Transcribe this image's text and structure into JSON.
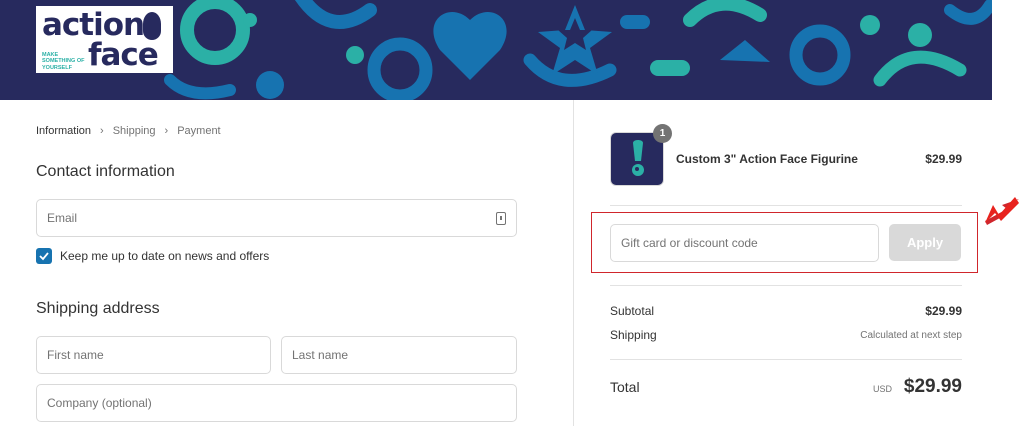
{
  "brand": {
    "logo_line1": "action",
    "logo_line2": "face",
    "tagline": "MAKE SOMETHING OF YOURSELF"
  },
  "breadcrumb": {
    "step1": "Information",
    "step2": "Shipping",
    "step3": "Payment"
  },
  "contact": {
    "title": "Contact information",
    "email_placeholder": "Email",
    "newsletter_label": "Keep me up to date on news and offers",
    "newsletter_checked": true
  },
  "shipping": {
    "title": "Shipping address",
    "first_name_placeholder": "First name",
    "last_name_placeholder": "Last name",
    "company_placeholder": "Company (optional)"
  },
  "cart": {
    "item": {
      "name": "Custom 3\" Action Face Figurine",
      "price": "$29.99",
      "quantity": "1"
    },
    "discount_placeholder": "Gift card or discount code",
    "apply_label": "Apply",
    "subtotal_label": "Subtotal",
    "subtotal_value": "$29.99",
    "shipping_label": "Shipping",
    "shipping_value": "Calculated at next step",
    "total_label": "Total",
    "currency": "USD",
    "total_value": "$29.99"
  },
  "colors": {
    "banner_bg": "#272a5e",
    "accent_teal": "#2bb0a6",
    "accent_blue": "#1773b0",
    "highlight_red": "#d0262c"
  }
}
